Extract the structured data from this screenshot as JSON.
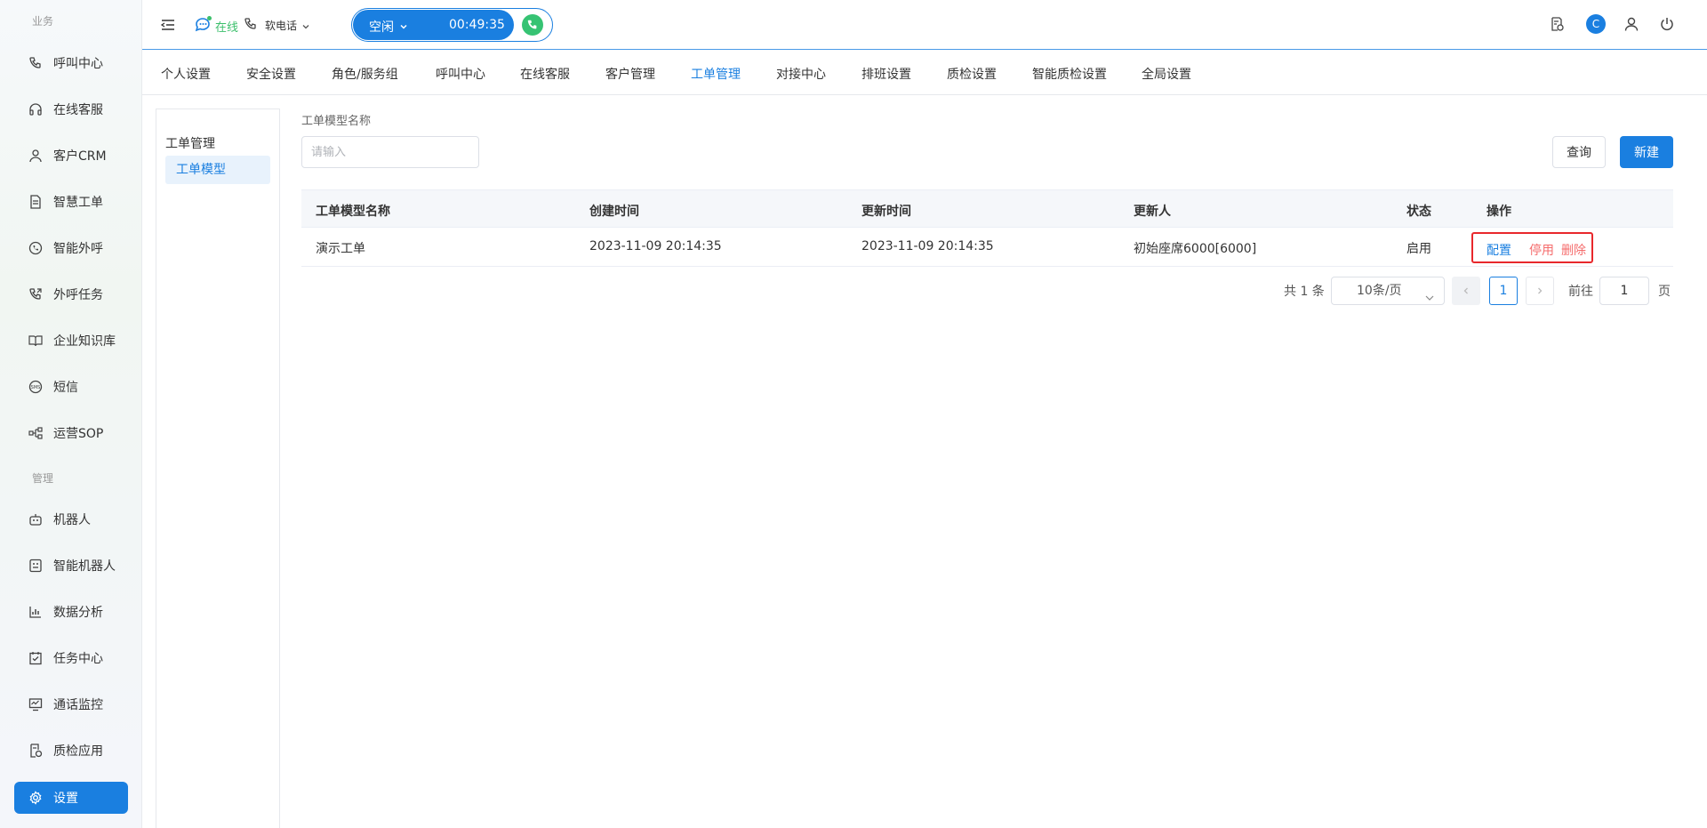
{
  "sidebar": {
    "section_business": "业务",
    "section_manage": "管理",
    "items": [
      {
        "label": "呼叫中心",
        "icon": "phone-icon"
      },
      {
        "label": "在线客服",
        "icon": "headset-icon"
      },
      {
        "label": "客户CRM",
        "icon": "user-icon"
      },
      {
        "label": "智慧工单",
        "icon": "document-icon"
      },
      {
        "label": "智能外呼",
        "icon": "whatsapp-phone-icon"
      },
      {
        "label": "外呼任务",
        "icon": "phone-outgoing-icon"
      },
      {
        "label": "企业知识库",
        "icon": "book-icon"
      },
      {
        "label": "短信",
        "icon": "sms-icon"
      },
      {
        "label": "运营SOP",
        "icon": "flow-icon"
      },
      {
        "label": "机器人",
        "icon": "robot-icon"
      },
      {
        "label": "智能机器人",
        "icon": "smart-robot-icon"
      },
      {
        "label": "数据分析",
        "icon": "bar-chart-icon"
      },
      {
        "label": "任务中心",
        "icon": "task-check-icon"
      },
      {
        "label": "通话监控",
        "icon": "monitor-icon"
      },
      {
        "label": "质检应用",
        "icon": "quality-doc-icon"
      },
      {
        "label": "设置",
        "icon": "gear-icon"
      }
    ]
  },
  "header": {
    "status": "在线",
    "phone_mode": "软电话",
    "call_state": "空闲",
    "call_timer": "00:49:35",
    "avatar_initial": "C"
  },
  "tabs": [
    "个人设置",
    "安全设置",
    "角色/服务组",
    "呼叫中心",
    "在线客服",
    "客户管理",
    "工单管理",
    "对接中心",
    "排班设置",
    "质检设置",
    "智能质检设置",
    "全局设置"
  ],
  "inner_nav": {
    "title": "工单管理",
    "item": "工单模型"
  },
  "search": {
    "label": "工单模型名称",
    "placeholder": "请输入",
    "query_button": "查询",
    "new_button": "新建"
  },
  "table": {
    "columns": [
      "工单模型名称",
      "创建时间",
      "更新时间",
      "更新人",
      "状态",
      "操作"
    ],
    "rows": [
      {
        "name": "演示工单",
        "created": "2023-11-09 20:14:35",
        "updated": "2023-11-09 20:14:35",
        "updater": "初始座席6000[6000]",
        "status": "启用",
        "actions": [
          "配置",
          "停用",
          "删除"
        ]
      }
    ]
  },
  "pagination": {
    "total": "共 1 条",
    "page_size": "10条/页",
    "current_page": "1",
    "goto_label": "前往",
    "goto_value": "1",
    "page_suffix": "页"
  },
  "colors": {
    "accent": "#1a7fe0",
    "online": "#3bbf6b",
    "danger": "#f56c6c",
    "highlight_box": "#e8282c"
  }
}
